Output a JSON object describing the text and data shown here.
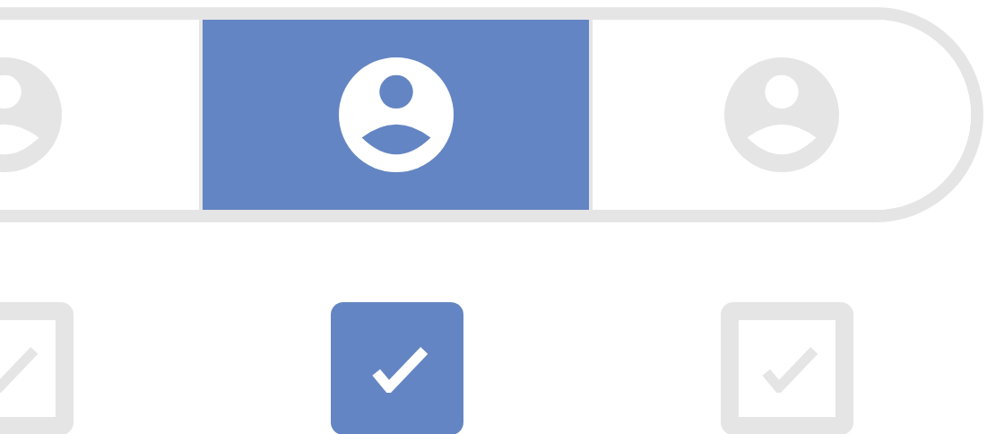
{
  "segments": [
    {
      "selected": false
    },
    {
      "selected": true
    },
    {
      "selected": false
    }
  ],
  "checkboxes": [
    {
      "checked": false
    },
    {
      "checked": true
    },
    {
      "checked": false
    }
  ]
}
